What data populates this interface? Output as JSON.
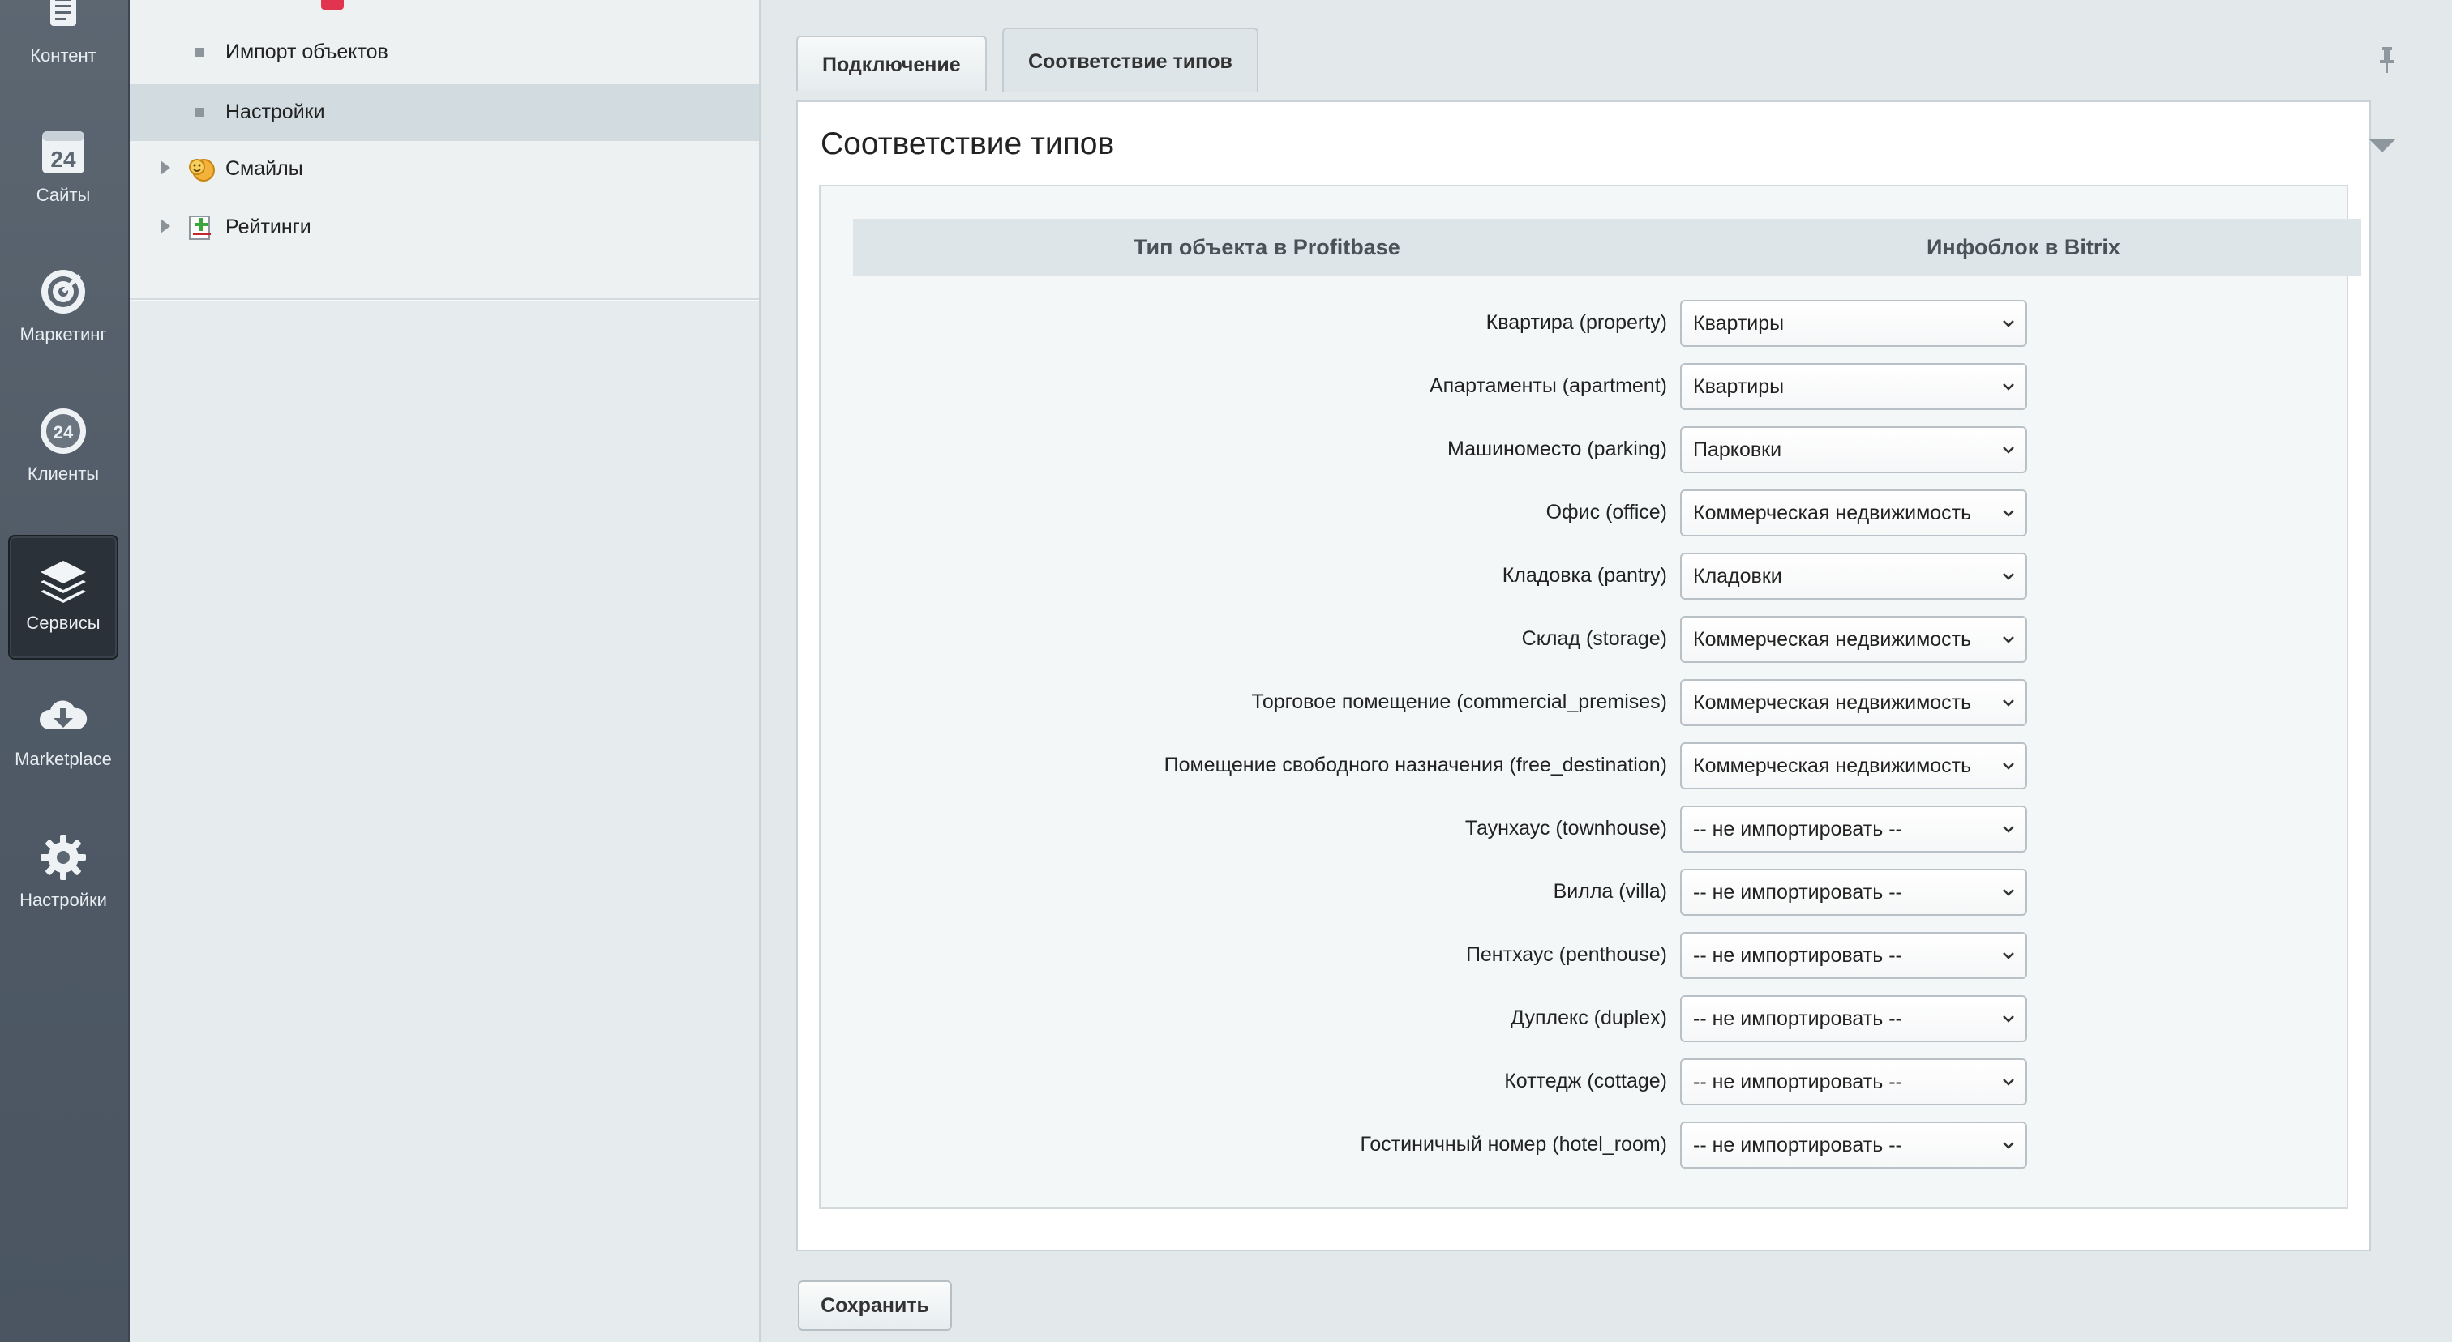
{
  "leftnav": {
    "items": [
      {
        "label": "Контент",
        "icon": "document-icon",
        "active": false
      },
      {
        "label": "Сайты",
        "icon": "calendar-24-icon",
        "active": false
      },
      {
        "label": "Маркетинг",
        "icon": "target-icon",
        "active": false
      },
      {
        "label": "Клиенты",
        "icon": "clients-24-icon",
        "active": false
      },
      {
        "label": "Сервисы",
        "icon": "layers-icon",
        "active": true
      },
      {
        "label": "Marketplace",
        "icon": "cloud-download-icon",
        "active": false
      },
      {
        "label": "Настройки",
        "icon": "gear-icon",
        "active": false
      }
    ]
  },
  "tree": {
    "items": [
      {
        "label": "Импорт объектов",
        "type": "leaf",
        "selected": false
      },
      {
        "label": "Настройки",
        "type": "leaf",
        "selected": true
      },
      {
        "label": "Смайлы",
        "type": "folder",
        "icon": "smiley-icon",
        "selected": false
      },
      {
        "label": "Рейтинги",
        "type": "folder",
        "icon": "rating-icon",
        "selected": false
      }
    ]
  },
  "tabs": [
    {
      "label": "Подключение",
      "active": false
    },
    {
      "label": "Соответствие типов",
      "active": true
    }
  ],
  "panel": {
    "title": "Соответствие типов",
    "col_profitbase": "Тип объекта в Profitbase",
    "col_bitrix": "Инфоблок в Bitrix"
  },
  "mappings": [
    {
      "label": "Квартира (property)",
      "value": "Квартиры"
    },
    {
      "label": "Апартаменты (apartment)",
      "value": "Квартиры"
    },
    {
      "label": "Машиноместо (parking)",
      "value": "Парковки"
    },
    {
      "label": "Офис (office)",
      "value": "Коммерческая недвижимость"
    },
    {
      "label": "Кладовка (pantry)",
      "value": "Кладовки"
    },
    {
      "label": "Склад (storage)",
      "value": "Коммерческая недвижимость"
    },
    {
      "label": "Торговое помещение (commercial_premises)",
      "value": "Коммерческая недвижимость"
    },
    {
      "label": "Помещение свободного назначения (free_destination)",
      "value": "Коммерческая недвижимость"
    },
    {
      "label": "Таунхаус (townhouse)",
      "value": "-- не импортировать --"
    },
    {
      "label": "Вилла (villa)",
      "value": "-- не импортировать --"
    },
    {
      "label": "Пентхаус (penthouse)",
      "value": "-- не импортировать --"
    },
    {
      "label": "Дуплекс (duplex)",
      "value": "-- не импортировать --"
    },
    {
      "label": "Коттедж (cottage)",
      "value": "-- не импортировать --"
    },
    {
      "label": "Гостиничный номер (hotel_room)",
      "value": "-- не импортировать --"
    }
  ],
  "save_label": "Сохранить",
  "colors": {
    "nav_bg": "#525d69",
    "tree_bg": "#e6ecee",
    "selected_row": "#d1dbe0",
    "accent_red": "#e0344f"
  }
}
